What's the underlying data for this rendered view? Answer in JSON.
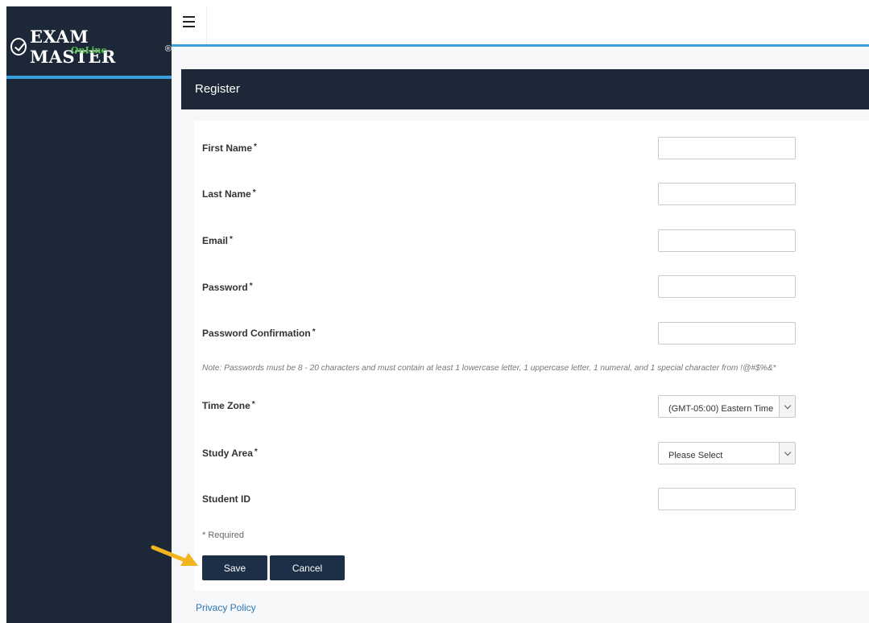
{
  "brand": {
    "name": "EXAM MASTER",
    "registered_mark": "®",
    "subtitle": "OnLine"
  },
  "panel": {
    "title": "Register"
  },
  "form": {
    "first_name": {
      "label": "First Name",
      "required_mark": "*",
      "value": ""
    },
    "last_name": {
      "label": "Last Name",
      "required_mark": "*",
      "value": ""
    },
    "email": {
      "label": "Email",
      "required_mark": "*",
      "value": ""
    },
    "password": {
      "label": "Password",
      "required_mark": "*",
      "value": ""
    },
    "password_confirmation": {
      "label": "Password Confirmation",
      "required_mark": "*",
      "value": ""
    },
    "note": "Note: Passwords must be 8 - 20 characters and must contain at least 1 lowercase letter, 1 uppercase letter, 1 numeral, and 1 special character from !@#$%&*",
    "time_zone": {
      "label": "Time Zone",
      "required_mark": "*",
      "selected": "(GMT-05:00) Eastern Time"
    },
    "study_area": {
      "label": "Study Area",
      "required_mark": "*",
      "selected": "Please Select"
    },
    "student_id": {
      "label": "Student ID",
      "value": ""
    },
    "required_note": "* Required"
  },
  "buttons": {
    "save": "Save",
    "cancel": "Cancel"
  },
  "footer": {
    "privacy_policy": "Privacy Policy"
  },
  "colors": {
    "navy": "#1c2838",
    "accent_blue": "#3aa0dc",
    "brand_green": "#56c24a",
    "button": "#1c2f46",
    "link": "#2b78b8",
    "annotation_arrow": "#f2b520"
  }
}
